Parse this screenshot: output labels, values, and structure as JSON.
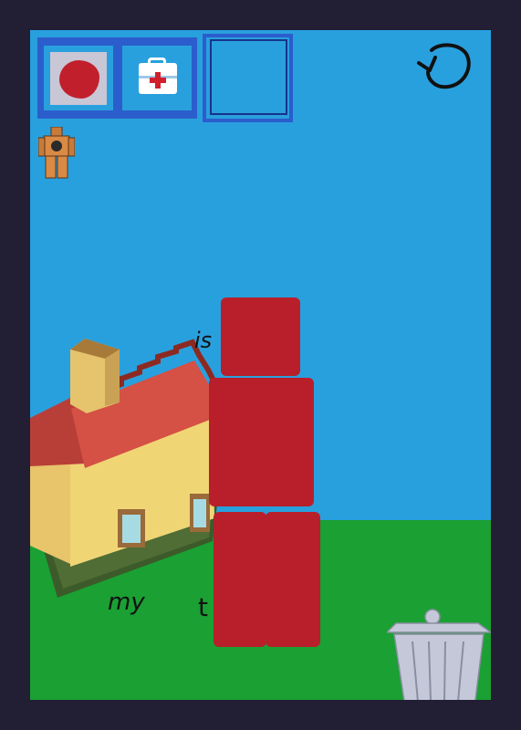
{
  "game": {
    "scene": "backyard",
    "sky_color": "#29a0de",
    "grass_color": "#1aa033",
    "frame_color": "#221e33",
    "block_color": "#b81f2b"
  },
  "inventory": {
    "slots": [
      {
        "item": "tomato-icon"
      },
      {
        "item": "first-aid-kit-icon"
      },
      {
        "item": "empty"
      }
    ]
  },
  "scene_text": {
    "word_is": "is",
    "word_my": "my",
    "word_t": "t"
  },
  "controls": {
    "reset": "reset-arrow-icon",
    "trash": "trash-can-icon"
  }
}
